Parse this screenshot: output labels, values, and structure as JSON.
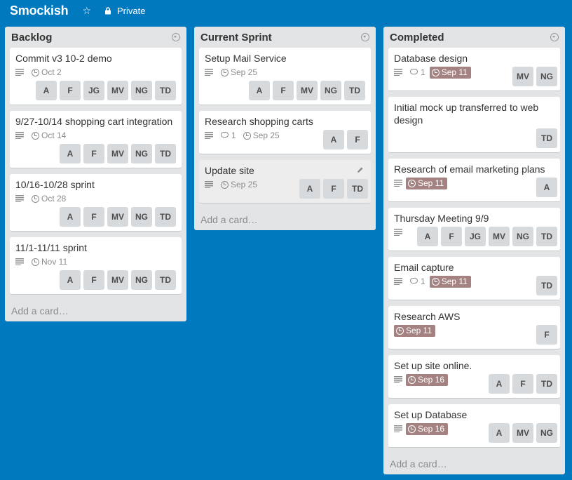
{
  "board": {
    "title": "Smockish",
    "privacy": "Private"
  },
  "add_card_label": "Add a card…",
  "colors": {
    "board_bg": "#0079bf",
    "list_bg": "#e2e4e6",
    "member_bg": "#d6dadc",
    "overdue_due": "#a48282"
  },
  "lists": [
    {
      "title": "Backlog",
      "cards": [
        {
          "title": "Commit v3 10-2 demo",
          "desc": true,
          "due": "Oct 2",
          "members": [
            "A",
            "F",
            "JG",
            "MV",
            "NG",
            "TD"
          ]
        },
        {
          "title": "9/27-10/14 shopping cart integration",
          "desc": true,
          "due": "Oct 14",
          "members": [
            "A",
            "F",
            "MV",
            "NG",
            "TD"
          ]
        },
        {
          "title": "10/16-10/28 sprint",
          "desc": true,
          "due": "Oct 28",
          "members": [
            "A",
            "F",
            "MV",
            "NG",
            "TD"
          ]
        },
        {
          "title": "11/1-11/11 sprint",
          "desc": true,
          "due": "Nov 11",
          "members": [
            "A",
            "F",
            "MV",
            "NG",
            "TD"
          ]
        }
      ]
    },
    {
      "title": "Current Sprint",
      "cards": [
        {
          "title": "Setup Mail Service",
          "desc": true,
          "due": "Sep 25",
          "members": [
            "A",
            "F",
            "MV",
            "NG",
            "TD"
          ]
        },
        {
          "title": "Research shopping carts",
          "desc": true,
          "comments": "1",
          "due": "Sep 25",
          "members": [
            "A",
            "F"
          ]
        },
        {
          "title": "Update site",
          "desc": true,
          "due": "Sep 25",
          "members": [
            "A",
            "F",
            "TD"
          ]
        }
      ]
    },
    {
      "title": "Completed",
      "cards": [
        {
          "title": "Database design",
          "desc": true,
          "comments": "1",
          "due": "Sep 11",
          "members": [
            "MV",
            "NG"
          ]
        },
        {
          "title": "Initial mock up transferred to web design",
          "members": [
            "TD"
          ]
        },
        {
          "title": "Research of email marketing plans",
          "desc": true,
          "due": "Sep 11",
          "members": [
            "A"
          ]
        },
        {
          "title": "Thursday Meeting 9/9",
          "desc": true,
          "members": [
            "A",
            "F",
            "JG",
            "MV",
            "NG",
            "TD"
          ]
        },
        {
          "title": "Email capture",
          "desc": true,
          "comments": "1",
          "due": "Sep 11",
          "members": [
            "TD"
          ]
        },
        {
          "title": "Research AWS",
          "due": "Sep 11",
          "members": [
            "F"
          ]
        },
        {
          "title": "Set up site online.",
          "desc": true,
          "due": "Sep 16",
          "members": [
            "A",
            "F",
            "TD"
          ]
        },
        {
          "title": "Set up Database",
          "desc": true,
          "due": "Sep 16",
          "members": [
            "A",
            "MV",
            "NG"
          ]
        }
      ]
    }
  ]
}
